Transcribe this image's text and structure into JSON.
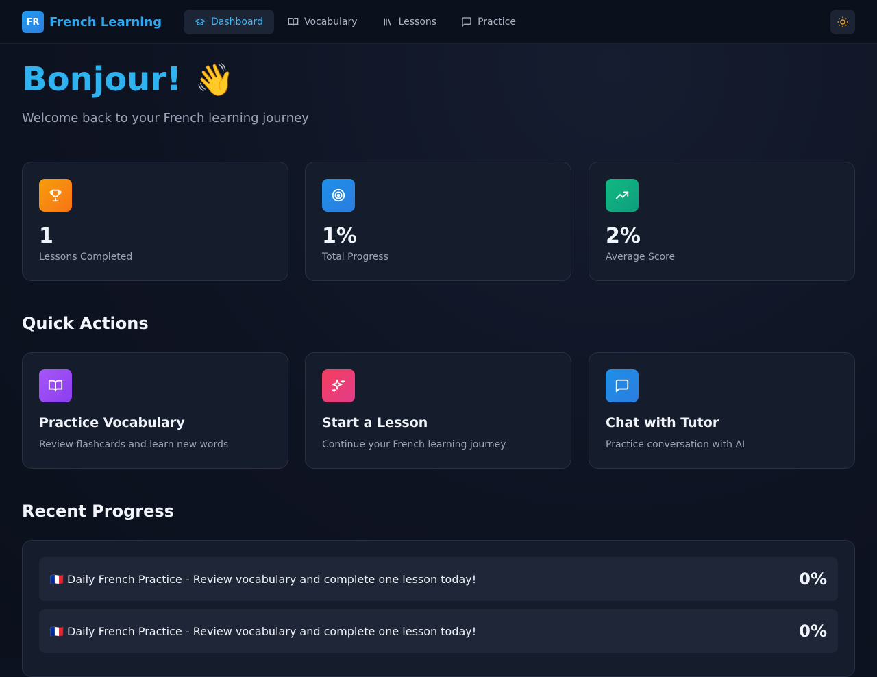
{
  "header": {
    "brand_badge": "FR",
    "brand_name": "French Learning",
    "nav": [
      {
        "label": "Dashboard",
        "icon": "graduation-cap-icon",
        "active": true
      },
      {
        "label": "Vocabulary",
        "icon": "book-open-icon",
        "active": false
      },
      {
        "label": "Lessons",
        "icon": "library-icon",
        "active": false
      },
      {
        "label": "Practice",
        "icon": "message-square-icon",
        "active": false
      }
    ],
    "theme_toggle_icon": "sun-icon"
  },
  "hero": {
    "title": "Bonjour!",
    "emoji": "👋",
    "subtitle": "Welcome back to your French learning journey"
  },
  "stats": [
    {
      "value": "1",
      "label": "Lessons Completed",
      "icon": "trophy-icon",
      "color": "#f59e0b"
    },
    {
      "value": "1%",
      "label": "Total Progress",
      "icon": "target-icon",
      "color": "#1e90e8"
    },
    {
      "value": "2%",
      "label": "Average Score",
      "icon": "trending-up-icon",
      "color": "#10a37f"
    }
  ],
  "quick_actions": {
    "title": "Quick Actions",
    "items": [
      {
        "title": "Practice Vocabulary",
        "desc": "Review flashcards and learn new words",
        "icon": "book-open-icon",
        "color": "#9b4df0"
      },
      {
        "title": "Start a Lesson",
        "desc": "Continue your French learning journey",
        "icon": "sparkles-icon",
        "color": "#ec3f7a"
      },
      {
        "title": "Chat with Tutor",
        "desc": "Practice conversation with AI",
        "icon": "message-square-icon",
        "color": "#1e90e8"
      }
    ]
  },
  "recent_progress": {
    "title": "Recent Progress",
    "items": [
      {
        "text": "🇫🇷 Daily French Practice - Review vocabulary and complete one lesson today!",
        "percent": "0%"
      },
      {
        "text": "🇫🇷 Daily French Practice - Review vocabulary and complete one lesson today!",
        "percent": "0%"
      }
    ]
  }
}
